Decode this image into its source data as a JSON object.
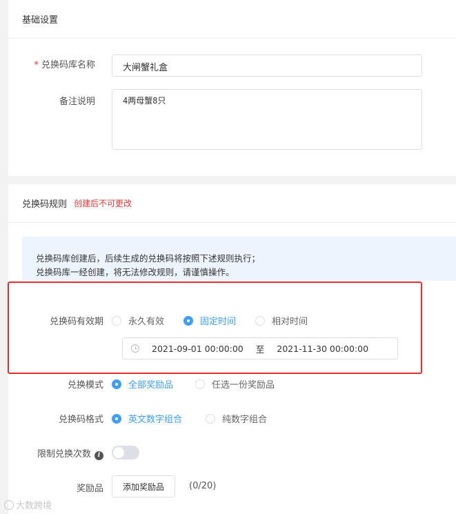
{
  "basic": {
    "title": "基础设置",
    "name_label": "兑换码库名称",
    "name_required": "*",
    "name_value": "大闸蟹礼盒",
    "remark_label": "备注说明",
    "remark_value": "4两母蟹8只"
  },
  "rules": {
    "title": "兑换码规则",
    "warning": "创建后不可更改",
    "notice_line1": "兑换码库创建后，后续生成的兑换码将按照下述规则执行；",
    "notice_line2": "兑换码库一经创建，将无法修改规则，请谨慎操作。",
    "validity_label": "兑换码有效期",
    "validity_options": [
      "永久有效",
      "固定时间",
      "相对时间"
    ],
    "validity_selected": "固定时间",
    "date_start": "2021-09-01 00:00:00",
    "date_sep": "至",
    "date_end": "2021-11-30 00:00:00",
    "mode_label": "兑换模式",
    "mode_options": [
      "全部奖励品",
      "任选一份奖励品"
    ],
    "mode_selected": "全部奖励品",
    "format_label": "兑换码格式",
    "format_options": [
      "英文数字组合",
      "纯数字组合"
    ],
    "format_selected": "英文数字组合",
    "limit_label": "限制兑换次数",
    "limit_enabled": false,
    "reward_label": "奖励品",
    "add_reward_button": "添加奖励品",
    "reward_count": "(0/20)"
  },
  "watermark": "大数跨境",
  "colors": {
    "primary": "#409eff",
    "danger": "#e4393c",
    "highlight_box": "#e42e2e"
  }
}
